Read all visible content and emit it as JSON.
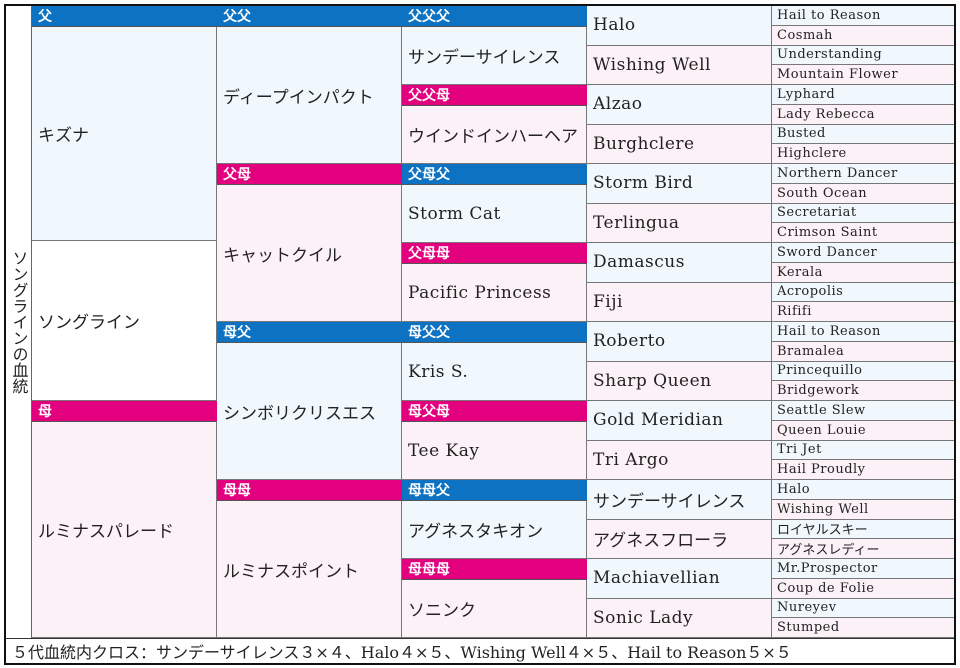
{
  "title": "ソングラインの血統",
  "colors": {
    "sire_header": "#0d72c2",
    "dam_header": "#e3007f",
    "sire_cell": "#f0f8fd",
    "dam_cell": "#fdf1f8"
  },
  "gen1": {
    "sire": {
      "header": "父",
      "name": "キズナ"
    },
    "subject": {
      "name": "ソングライン"
    },
    "dam": {
      "header": "母",
      "name": "ルミナスパレード"
    }
  },
  "gen2": [
    {
      "header": "父父",
      "name": "ディープインパクト"
    },
    {
      "header": "父母",
      "name": "キャットクイル"
    },
    {
      "header": "母父",
      "name": "シンボリクリスエス"
    },
    {
      "header": "母母",
      "name": "ルミナスポイント"
    }
  ],
  "gen3": [
    {
      "header": "父父父",
      "name": "サンデーサイレンス"
    },
    {
      "header": "父父母",
      "name": "ウインドインハーヘア"
    },
    {
      "header": "父母父",
      "name": "Storm Cat"
    },
    {
      "header": "父母母",
      "name": "Pacific Princess"
    },
    {
      "header": "母父父",
      "name": "Kris S."
    },
    {
      "header": "母父母",
      "name": "Tee Kay"
    },
    {
      "header": "母母父",
      "name": "アグネスタキオン"
    },
    {
      "header": "母母母",
      "name": "ソニンク"
    }
  ],
  "gen4": [
    "Halo",
    "Wishing Well",
    "Alzao",
    "Burghclere",
    "Storm Bird",
    "Terlingua",
    "Damascus",
    "Fiji",
    "Roberto",
    "Sharp Queen",
    "Gold Meridian",
    "Tri Argo",
    "サンデーサイレンス",
    "アグネスフローラ",
    "Machiavellian",
    "Sonic Lady"
  ],
  "gen5": [
    "Hail to Reason",
    "Cosmah",
    "Understanding",
    "Mountain Flower",
    "Lyphard",
    "Lady Rebecca",
    "Busted",
    "Highclere",
    "Northern Dancer",
    "South Ocean",
    "Secretariat",
    "Crimson Saint",
    "Sword Dancer",
    "Kerala",
    "Acropolis",
    "Rififi",
    "Hail to Reason",
    "Bramalea",
    "Princequillo",
    "Bridgework",
    "Seattle Slew",
    "Queen Louie",
    "Tri Jet",
    "Hail Proudly",
    "Halo",
    "Wishing Well",
    "ロイヤルスキー",
    "アグネスレディー",
    "Mr.Prospector",
    "Coup de Folie",
    "Nureyev",
    "Stumped"
  ],
  "footer": "５代血統内クロス：サンデーサイレンス３×４、Halo４×５、Wishing Well４×５、Hail to Reason５×５"
}
